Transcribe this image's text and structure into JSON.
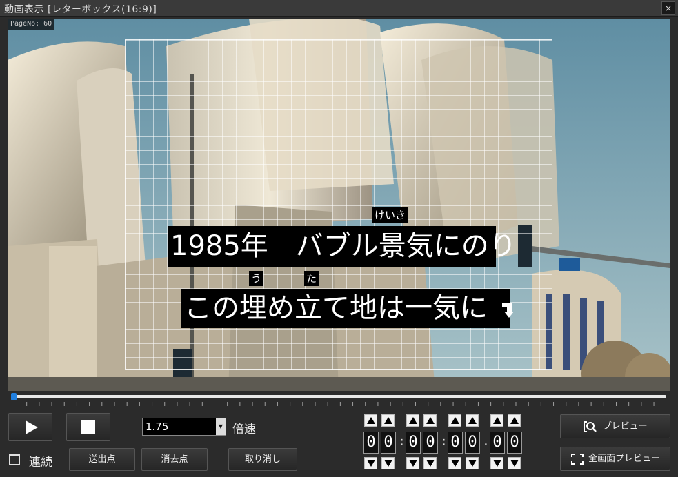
{
  "window": {
    "title": "動画表示 [レターボックス(16:9)]",
    "close_label": "×"
  },
  "video": {
    "page_no": "PageNo: 60",
    "subtitle_line1": "1985年　バブル景気にのり",
    "subtitle_line2": "この埋め立て地は一気に",
    "ruby": [
      "けいき",
      "う",
      "た"
    ]
  },
  "controls": {
    "speed_value": "1.75",
    "speed_unit": "倍速",
    "continuous_label": "連続",
    "continuous_checked": false,
    "send_point_label": "送出点",
    "erase_point_label": "消去点",
    "undo_label": "取り消し",
    "preview_label": "プレビュー",
    "fullscreen_preview_label": "全画面プレビュー"
  },
  "timecode": {
    "digits": [
      "0",
      "0",
      "0",
      "0",
      "0",
      "0",
      "0",
      "0"
    ],
    "separators": [
      ":",
      ":",
      "."
    ]
  },
  "seek": {
    "position": 0.0
  },
  "colors": {
    "accent": "#1f7fe0",
    "background": "#2b2b2b"
  }
}
